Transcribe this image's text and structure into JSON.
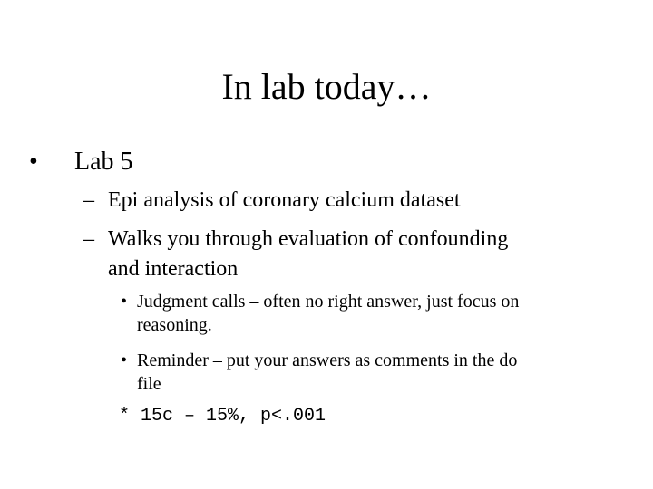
{
  "slide": {
    "title": "In lab today…",
    "level1": {
      "bullet": "•",
      "text": "Lab 5"
    },
    "level2": [
      {
        "marker": "–",
        "lines": [
          "Epi analysis of coronary calcium dataset"
        ]
      },
      {
        "marker": "–",
        "lines": [
          "Walks you through evaluation of confounding",
          "and interaction"
        ]
      }
    ],
    "level3": [
      {
        "marker": "•",
        "lines": [
          "Judgment calls – often no right answer, just focus on",
          "reasoning."
        ]
      },
      {
        "marker": "•",
        "lines": [
          "Reminder – put your answers as comments in the do",
          "file"
        ]
      }
    ],
    "code_line": "* 15c – 15%, p<.001"
  }
}
